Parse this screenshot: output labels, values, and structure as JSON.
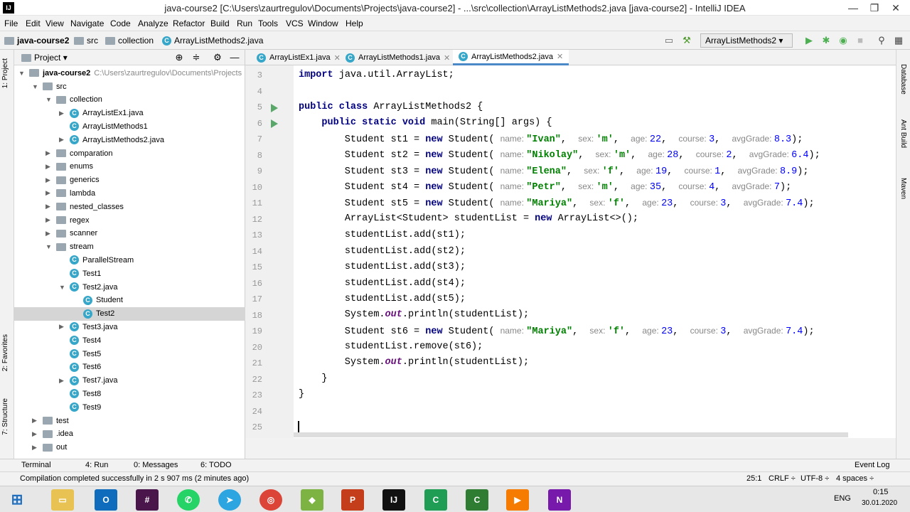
{
  "window": {
    "title": "java-course2 [C:\\Users\\zaurtregulov\\Documents\\Projects\\java-course2] - ...\\src\\collection\\ArrayListMethods2.java [java-course2] - IntelliJ IDEA",
    "minimize": "—",
    "maximize": "❐",
    "close": "✕"
  },
  "menu": [
    "File",
    "Edit",
    "View",
    "Navigate",
    "Code",
    "Analyze",
    "Refactor",
    "Build",
    "Run",
    "Tools",
    "VCS",
    "Window",
    "Help"
  ],
  "breadcrumb": [
    "java-course2",
    "src",
    "collection",
    "ArrayListMethods2.java"
  ],
  "run_config": "ArrayListMethods2",
  "project_panel": {
    "title": "Project",
    "root": "java-course2",
    "root_path": "C:\\Users\\zaurtregulov\\Documents\\Projects",
    "items": [
      {
        "label": "src",
        "arrow": "▼",
        "icon": "folder"
      },
      {
        "label": "collection",
        "arrow": "▼",
        "icon": "folder"
      },
      {
        "label": "ArrayListEx1.java",
        "arrow": "▶",
        "icon": "class"
      },
      {
        "label": "ArrayListMethods1",
        "arrow": "",
        "icon": "class"
      },
      {
        "label": "ArrayListMethods2.java",
        "arrow": "▶",
        "icon": "class"
      },
      {
        "label": "comparation",
        "arrow": "▶",
        "icon": "folder"
      },
      {
        "label": "enums",
        "arrow": "▶",
        "icon": "folder"
      },
      {
        "label": "generics",
        "arrow": "▶",
        "icon": "folder"
      },
      {
        "label": "lambda",
        "arrow": "▶",
        "icon": "folder"
      },
      {
        "label": "nested_classes",
        "arrow": "▶",
        "icon": "folder"
      },
      {
        "label": "regex",
        "arrow": "▶",
        "icon": "folder"
      },
      {
        "label": "scanner",
        "arrow": "▶",
        "icon": "folder"
      },
      {
        "label": "stream",
        "arrow": "▼",
        "icon": "folder"
      },
      {
        "label": "ParallelStream",
        "arrow": "",
        "icon": "class"
      },
      {
        "label": "Test1",
        "arrow": "",
        "icon": "class"
      },
      {
        "label": "Test2.java",
        "arrow": "▼",
        "icon": "class"
      },
      {
        "label": "Student",
        "arrow": "",
        "icon": "class"
      },
      {
        "label": "Test2",
        "arrow": "",
        "icon": "class"
      },
      {
        "label": "Test3.java",
        "arrow": "▶",
        "icon": "class"
      },
      {
        "label": "Test4",
        "arrow": "",
        "icon": "class"
      },
      {
        "label": "Test5",
        "arrow": "",
        "icon": "class"
      },
      {
        "label": "Test6",
        "arrow": "",
        "icon": "class"
      },
      {
        "label": "Test7.java",
        "arrow": "▶",
        "icon": "class"
      },
      {
        "label": "Test8",
        "arrow": "",
        "icon": "class"
      },
      {
        "label": "Test9",
        "arrow": "",
        "icon": "class"
      },
      {
        "label": "test",
        "arrow": "▶",
        "icon": "folder"
      },
      {
        "label": ".idea",
        "arrow": "▶",
        "icon": "folder"
      },
      {
        "label": "out",
        "arrow": "▶",
        "icon": "folder"
      }
    ]
  },
  "tabs": [
    "ArrayListEx1.java",
    "ArrayListMethods1.java",
    "ArrayListMethods2.java"
  ],
  "editor": {
    "line_numbers": [
      "3",
      "4",
      "5",
      "6",
      "7",
      "8",
      "9",
      "10",
      "11",
      "12",
      "13",
      "14",
      "15",
      "16",
      "17",
      "18",
      "19",
      "20",
      "21",
      "22",
      "23",
      "24",
      "25"
    ],
    "students": [
      {
        "var": "st1",
        "name": "\"Ivan\"",
        "sex": "'m'",
        "age": "22",
        "course": "3",
        "avg": "8.3"
      },
      {
        "var": "st2",
        "name": "\"Nikolay\"",
        "sex": "'m'",
        "age": "28",
        "course": "2",
        "avg": "6.4"
      },
      {
        "var": "st3",
        "name": "\"Elena\"",
        "sex": "'f'",
        "age": "19",
        "course": "1",
        "avg": "8.9"
      },
      {
        "var": "st4",
        "name": "\"Petr\"",
        "sex": "'m'",
        "age": "35",
        "course": "4",
        "avg": "7"
      },
      {
        "var": "st5",
        "name": "\"Mariya\"",
        "sex": "'f'",
        "age": "23",
        "course": "3",
        "avg": "7.4"
      },
      {
        "var": "st6",
        "name": "\"Mariya\"",
        "sex": "'f'",
        "age": "23",
        "course": "3",
        "avg": "7.4"
      }
    ],
    "lines": {
      "l3": "java.util.ArrayList;",
      "l5_class": "ArrayListMethods2 {",
      "l6_main": "main(String[] args) {",
      "l12": "ArrayList<Student> studentList = ",
      "l12b": "ArrayList<>();",
      "add": [
        "studentList.add(st1);",
        "studentList.add(st2);",
        "studentList.add(st3);",
        "studentList.add(st4);",
        "studentList.add(st5);"
      ],
      "remove": "studentList.remove(st6);",
      "println": "println(studentList);",
      "close_brace": "}"
    }
  },
  "bottom_tools": [
    "Terminal",
    "4: Run",
    "0: Messages",
    "6: TODO",
    "Event Log"
  ],
  "status": {
    "message": "Compilation completed successfully in 2 s 907 ms (2 minutes ago)",
    "position": "25:1",
    "line_sep": "CRLF ÷",
    "encoding": "UTF-8 ÷",
    "indent": "4 spaces ÷"
  },
  "side_labels": {
    "left": [
      "1: Project",
      "2: Favorites",
      "7: Structure"
    ],
    "right": [
      "Database",
      "Ant Build",
      "Maven"
    ]
  },
  "taskbar": {
    "lang": "ENG",
    "time": "0:15",
    "date": "30.01.2020"
  }
}
